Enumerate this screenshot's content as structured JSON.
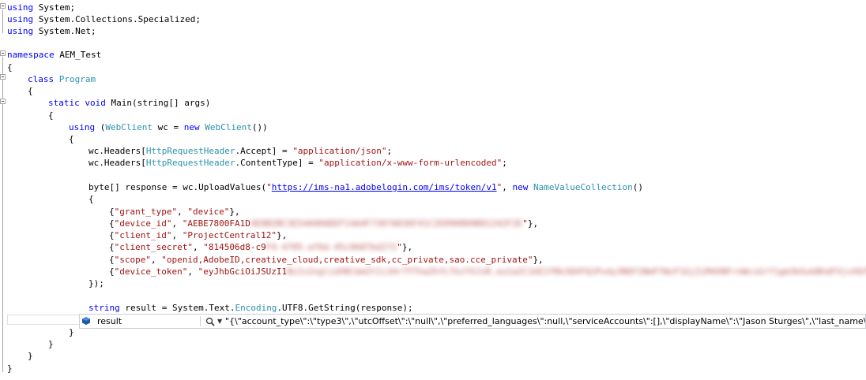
{
  "code": {
    "l1": {
      "kw": "using",
      "rest": " System;"
    },
    "l2": {
      "kw": "using",
      "rest": " System.Collections.Specialized;"
    },
    "l3": {
      "kw": "using",
      "rest": " System.Net;"
    },
    "l5": {
      "kw": "namespace",
      "rest": " AEM_Test"
    },
    "l6": "{",
    "l7": {
      "kw": "class",
      "type": "Program"
    },
    "l8": "{",
    "l9": {
      "kw1": "static",
      "kw2": "void",
      "rest": " Main(string[] args)"
    },
    "l10": "{",
    "l11": {
      "kw": "using",
      "p1": " (",
      "type1": "WebClient",
      "p2": " wc = ",
      "kw2": "new",
      "type2": "WebClient",
      "p3": "())"
    },
    "l12": "{",
    "l13": {
      "p1": "wc.Headers[",
      "type": "HttpRequestHeader",
      "p2": ".Accept] = ",
      "str": "\"application/json\"",
      "p3": ";"
    },
    "l14": {
      "p1": "wc.Headers[",
      "type": "HttpRequestHeader",
      "p2": ".ContentType] = ",
      "str": "\"application/x-www-form-urlencoded\"",
      "p3": ";"
    },
    "l16": {
      "p1": "byte[] response = wc.UploadValues(",
      "q1": "\"",
      "url": "https://ims-na1.adobelogin.com/ims/token/v1",
      "q2": "\"",
      "p2": ", ",
      "kw": "new",
      "type": "NameValueCollection",
      "p3": "()"
    },
    "l17": "{",
    "l18": {
      "p1": "{",
      "s1": "\"grant_type\"",
      "p2": ", ",
      "s2": "\"device\"",
      "p3": "},"
    },
    "l19": {
      "p1": "{",
      "s1": "\"device_id\"",
      "p2": ", ",
      "s2": "\"AEBE7800FA1D",
      "blur": "4E8B2BC3E54A90ADEF14A4F7307A036F41C2E0900D0B91242F2E",
      "s3": "\"",
      "p3": "},"
    },
    "l20": {
      "p1": "{",
      "s1": "\"client_id\"",
      "p2": ", ",
      "s2": "\"ProjectCentral12\"",
      "p3": "},"
    },
    "l21": {
      "p1": "{",
      "s1": "\"client_secret\"",
      "p2": ", ",
      "s2": "\"814506d8-c9",
      "blur": "F4-4705-af6d-45c9687bd272",
      "s3": "\"",
      "p3": "},"
    },
    "l22": {
      "p1": "{",
      "s1": "\"scope\"",
      "p2": ", ",
      "s2": "\"openid,AdobeID,creative_cloud,creative_sdk,cc_private,sao.cce_private\"",
      "p3": "},"
    },
    "l23": {
      "p1": "{",
      "s1": "\"device_token\"",
      "p2": ", ",
      "s2": "\"eyJhbGciOiJSUzI1",
      "blur": "NiIsInglidXNlbmZtIi1Hr7YThaZhfLTkzYXJsR.eu1a2C1kE1YRk3QVFQ1Pvdy3NQY1NmFfWzF1GjZiM4XNFrnWcsGrY1gm3bSukBhdFVjsVQfN"
    },
    "l24": "});",
    "l26": {
      "kw": "string",
      "rest": " result = System.Text.",
      "type": "Encoding",
      "rest2": ".UTF8.GetString(response);"
    },
    "l28": "}",
    "l29": "}",
    "l30": "}",
    "l31": "}"
  },
  "datatip": {
    "icon": "variable-icon",
    "name": "result",
    "value": "\"{\\\"account_type\\\":\\\"type3\\\",\\\"utcOffset\\\":\\\"null\\\",\\\"preferred_languages\\\":null,\\\"serviceAccounts\\\":[],\\\"displayName\\\":\\\"Jason Sturges\\\",\\\"last_name\\\":\\\"Sturges\\\",\\\"token..."
  },
  "colors": {
    "keyword": "#0000ff",
    "type": "#2b91af",
    "string": "#a31515"
  }
}
